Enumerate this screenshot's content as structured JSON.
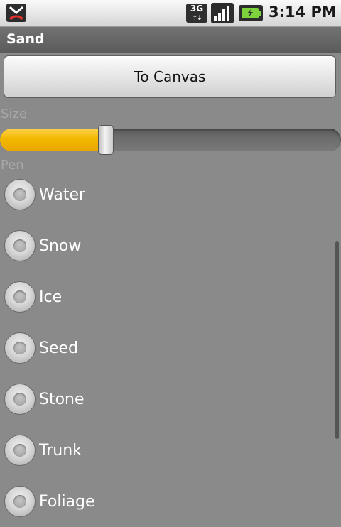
{
  "status_bar": {
    "network_type": "3G",
    "time": "3:14 PM",
    "icons": [
      "missed-call-icon",
      "network-3g-icon",
      "signal-strength-icon",
      "battery-charging-icon"
    ]
  },
  "app": {
    "title": "Sand"
  },
  "toolbar": {
    "to_canvas_label": "To Canvas"
  },
  "size": {
    "label": "Size",
    "value_percent": 31
  },
  "pen": {
    "label": "Pen",
    "options": [
      {
        "label": "Water",
        "selected": false
      },
      {
        "label": "Snow",
        "selected": false
      },
      {
        "label": "Ice",
        "selected": false
      },
      {
        "label": "Seed",
        "selected": false
      },
      {
        "label": "Stone",
        "selected": false
      },
      {
        "label": "Trunk",
        "selected": false
      },
      {
        "label": "Foliage",
        "selected": false
      }
    ]
  },
  "colors": {
    "slider_accent": "#f2b800",
    "background": "#8a8a8a",
    "title_bar": "#656565"
  }
}
